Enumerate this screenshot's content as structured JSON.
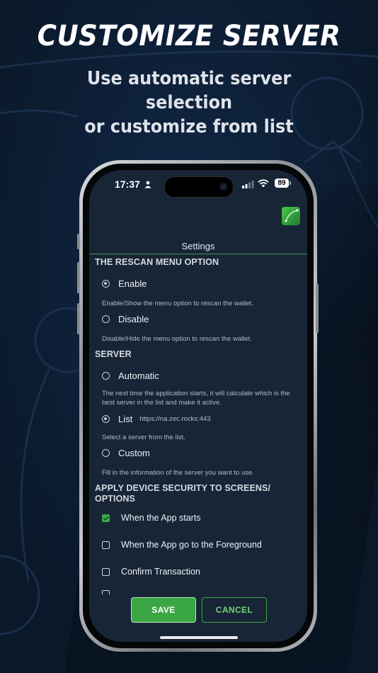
{
  "promo": {
    "headline": "CUSTOMIZE SERVER",
    "subheadline_line1": "Use automatic server selection",
    "subheadline_line2": "or customize from list"
  },
  "status_bar": {
    "time": "17:37",
    "battery": "89",
    "icons": [
      "person-icon",
      "signal-icon",
      "wifi-icon",
      "battery-icon"
    ]
  },
  "header": {
    "title": "Settings",
    "logo_icon": "leaf-logo-icon"
  },
  "rescan": {
    "heading": "THE RESCAN MENU OPTION",
    "options": [
      {
        "label": "Enable",
        "description": "Enable/Show the menu option to rescan the wallet.",
        "selected": true
      },
      {
        "label": "Disable",
        "description": "Disable/Hide the menu option to rescan the wallet.",
        "selected": false
      }
    ]
  },
  "server": {
    "heading": "SERVER",
    "options": [
      {
        "label": "Automatic",
        "description": "The next time the application starts, it will calculate which is the best server in the list and make it active.",
        "selected": false
      },
      {
        "label": "List",
        "value": "https://na.zec.rocks:443",
        "description": "Select a server from the list.",
        "selected": true
      },
      {
        "label": "Custom",
        "description": "Fill in the information of the server you want to use.",
        "selected": false
      }
    ]
  },
  "security": {
    "heading": "APPLY DEVICE SECURITY TO SCREENS/ OPTIONS",
    "options": [
      {
        "label": "When the App starts",
        "checked": true
      },
      {
        "label": "When the App go to the Foreground",
        "checked": false
      },
      {
        "label": "Confirm Transaction",
        "checked": false
      }
    ]
  },
  "actions": {
    "save_label": "SAVE",
    "cancel_label": "CANCEL"
  },
  "colors": {
    "background": "#0b1a2e",
    "screen": "#172536",
    "accent": "#3aa744"
  }
}
